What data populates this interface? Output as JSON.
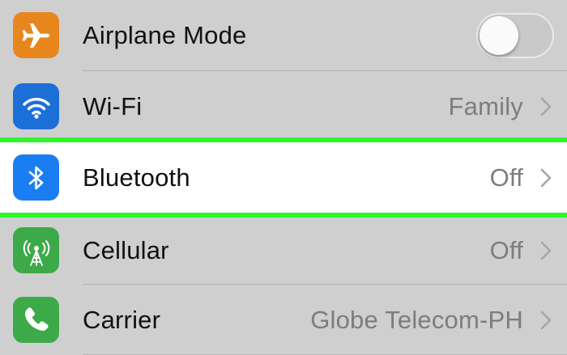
{
  "colors": {
    "background": "#cfcfcf",
    "highlight_bg": "#ffffff",
    "highlight_border": "#2ff52a",
    "airplane": "#e8861e",
    "wifi": "#1d6fd8",
    "bluetooth": "#1a7ef2",
    "cellular": "#3daa4a",
    "carrier": "#3daa4a",
    "value_text": "#7d7d7d"
  },
  "settings": {
    "airplane": {
      "label": "Airplane Mode",
      "icon": "airplane-icon",
      "toggle_on": false
    },
    "wifi": {
      "label": "Wi-Fi",
      "value": "Family",
      "icon": "wifi-icon"
    },
    "bluetooth": {
      "label": "Bluetooth",
      "value": "Off",
      "icon": "bluetooth-icon"
    },
    "cellular": {
      "label": "Cellular",
      "value": "Off",
      "icon": "cellular-antenna-icon"
    },
    "carrier": {
      "label": "Carrier",
      "value": "Globe Telecom-PH",
      "icon": "phone-icon"
    }
  }
}
